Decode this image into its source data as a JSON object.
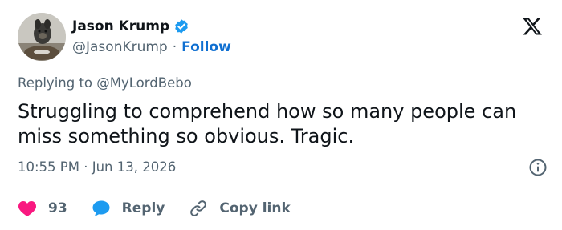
{
  "author": {
    "display_name": "Jason Krump",
    "handle": "@JasonKrump",
    "separator": "·",
    "follow_label": "Follow",
    "verified_icon": "verified-badge-icon",
    "avatar": "avatar-photo-dog"
  },
  "brand": {
    "logo": "x-logo-icon"
  },
  "tweet": {
    "replying_prefix": "Replying to ",
    "replying_to": "@MyLordBebo",
    "text": "Struggling to comprehend how so many people can miss something so obvious. Tragic.",
    "timestamp": "10:55 PM · Jun 13, 2026"
  },
  "actions": {
    "like_count": "93",
    "reply_label": "Reply",
    "copy_link_label": "Copy link"
  },
  "colors": {
    "accent": "#1d9bf0",
    "follow": "#0f6fd1",
    "like": "#f91880",
    "muted": "#536471",
    "text": "#0f1419"
  }
}
